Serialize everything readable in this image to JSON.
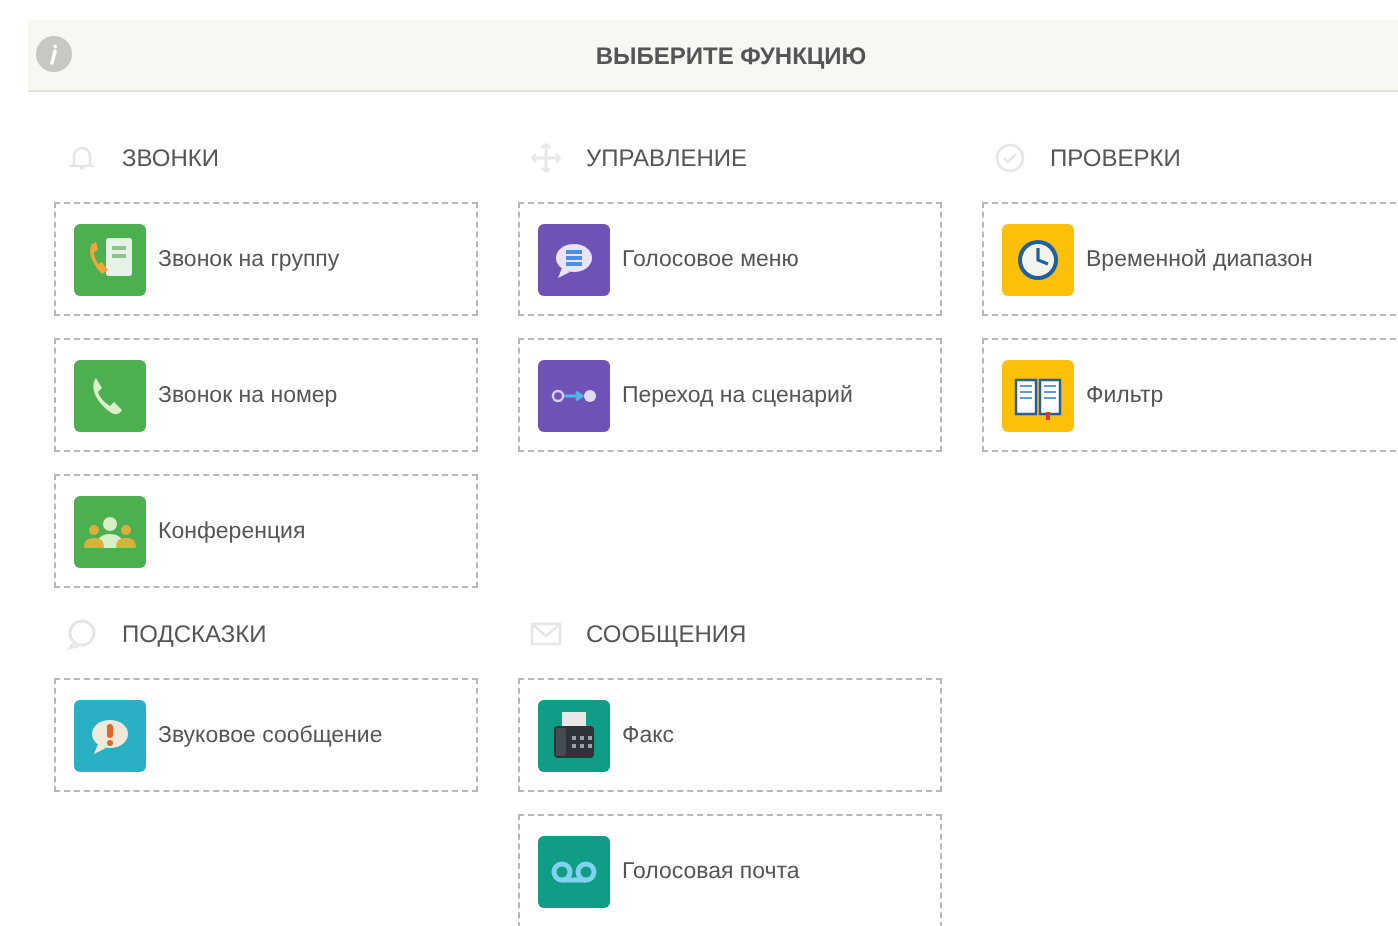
{
  "header": {
    "title": "ВЫБЕРИТЕ ФУНКЦИЮ"
  },
  "sections": [
    {
      "title": "ЗВОНКИ",
      "kind": "bell",
      "items": [
        {
          "label": "Звонок на группу",
          "kind": "contact-phone",
          "color": "#4caf50"
        },
        {
          "label": "Звонок на номер",
          "kind": "phone",
          "color": "#4caf50"
        },
        {
          "label": "Конференция",
          "kind": "people",
          "color": "#4caf50"
        }
      ]
    },
    {
      "title": "УПРАВЛЕНИЕ",
      "kind": "move",
      "items": [
        {
          "label": "Голосовое меню",
          "kind": "list-bubble",
          "color": "#6f52b5"
        },
        {
          "label": "Переход на сценарий",
          "kind": "arrow-dots",
          "color": "#6f52b5"
        }
      ]
    },
    {
      "title": "ПРОВЕРКИ",
      "kind": "check",
      "items": [
        {
          "label": "Временной диапазон",
          "kind": "clock",
          "color": "#fbc10a"
        },
        {
          "label": "Фильтр",
          "kind": "book",
          "color": "#fbc10a"
        }
      ]
    },
    {
      "title": "ПОДСКАЗКИ",
      "kind": "bubble",
      "items": [
        {
          "label": "Звуковое сообщение",
          "kind": "info-bubble",
          "color": "#2ab0c5"
        }
      ]
    },
    {
      "title": "СООБЩЕНИЯ",
      "kind": "envelope",
      "items": [
        {
          "label": "Факс",
          "kind": "fax",
          "color": "#109d86"
        },
        {
          "label": "Голосовая почта",
          "kind": "voicemail",
          "color": "#109d86"
        }
      ]
    }
  ]
}
